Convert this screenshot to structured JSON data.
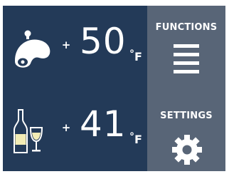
{
  "zones": [
    {
      "icon": "meat-icon",
      "sign": "+",
      "temperature": "50",
      "degree_symbol": "°",
      "unit": "F"
    },
    {
      "icon": "wine-bottle-glass-icon",
      "sign": "+",
      "temperature": "41",
      "degree_symbol": "°",
      "unit": "F"
    }
  ],
  "sidebar": {
    "functions_label": "FUNCTIONS",
    "settings_label": "SETTINGS"
  },
  "icons": {
    "functions": "menu-icon",
    "settings": "gear-icon"
  },
  "colors": {
    "main_background": "#233a58",
    "sidebar_background": "#586577",
    "text": "#ffffff",
    "wine_fill": "#f2ecb5"
  }
}
